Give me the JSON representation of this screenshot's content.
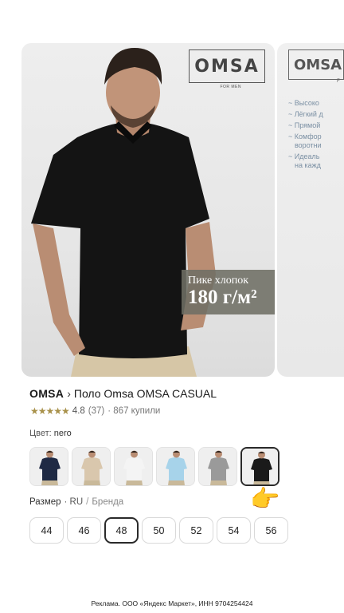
{
  "gallery": {
    "main": {
      "logo": "OMSA",
      "logo_sub": "FOR MEN",
      "badge_line1": "Пике хлопок",
      "badge_line2": "180 г/м²"
    },
    "next": {
      "logo": "OMSA",
      "logo_sub": "F",
      "features": [
        "~ Высоко",
        "~ Лёгкий д",
        "~ Прямой",
        "~ Комфор",
        "воротни",
        "~ Идеаль",
        "на кажд"
      ]
    }
  },
  "product": {
    "brand": "OMSA",
    "chevron": "›",
    "name": "Поло Omsa OMSA CASUAL",
    "stars": "★★★★★",
    "rating": "4.8",
    "reviews": "(37)",
    "sold": "· 867 купили"
  },
  "color": {
    "label": "Цвет:",
    "value": "nero",
    "swatches": [
      {
        "name": "navy",
        "shirt": "#1f2a44",
        "pants": "#c9b99a"
      },
      {
        "name": "beige",
        "shirt": "#d9c7ad",
        "pants": "#c9b99a"
      },
      {
        "name": "white",
        "shirt": "#f4f4f4",
        "pants": "#c9b99a"
      },
      {
        "name": "light-blue",
        "shirt": "#a7d3ea",
        "pants": "#c9b99a"
      },
      {
        "name": "grey",
        "shirt": "#9a9a9a",
        "pants": "#c9b99a"
      },
      {
        "name": "nero",
        "shirt": "#1a1a1a",
        "pants": "#c9b99a"
      }
    ],
    "selected_index": 5
  },
  "size": {
    "label": "Размер",
    "system": "· RU",
    "separator": "/",
    "alt": "Бренда",
    "options": [
      "44",
      "46",
      "48",
      "50",
      "52",
      "54",
      "56"
    ],
    "selected": "48"
  },
  "pointer": "👉",
  "footer": {
    "text": "Реклама. ООО «Яндекс Маркет», ИНН 9704254424"
  }
}
